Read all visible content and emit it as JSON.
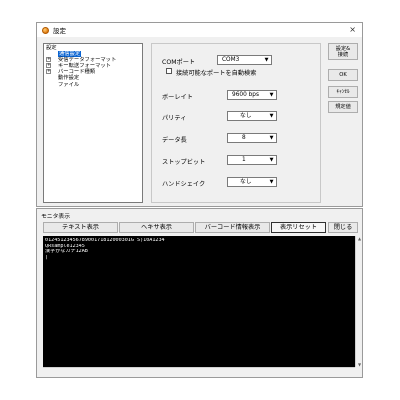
{
  "dialog": {
    "title": "設定",
    "close_icon": "×",
    "tree": [
      {
        "label": "設定",
        "indent": 0,
        "expander": "",
        "selected": false
      },
      {
        "label": "通信設定",
        "indent": 1,
        "expander": "",
        "selected": true
      },
      {
        "label": "受信データフォーマット",
        "indent": 1,
        "expander": "+",
        "selected": false
      },
      {
        "label": "キー転送フォーマット",
        "indent": 1,
        "expander": "+",
        "selected": false
      },
      {
        "label": "バーコード種類",
        "indent": 1,
        "expander": "+",
        "selected": false
      },
      {
        "label": "動作設定",
        "indent": 1,
        "expander": "",
        "selected": false
      },
      {
        "label": "ファイル",
        "indent": 1,
        "expander": "",
        "selected": false
      }
    ],
    "com_port": {
      "label": "COMポート",
      "value": "COM3"
    },
    "auto_search": {
      "label": "接続可能なポートを自動検索",
      "checked": false
    },
    "baud_rate": {
      "label": "ボーレイト",
      "value": "9600 bps"
    },
    "parity": {
      "label": "パリティ",
      "value": "なし"
    },
    "data_length": {
      "label": "データ長",
      "value": "8"
    },
    "stop_bit": {
      "label": "ストップビット",
      "value": "1"
    },
    "handshake": {
      "label": "ハンドシェイク",
      "value": "なし"
    },
    "buttons": {
      "apply": "設定&\n接続",
      "ok": "OK",
      "cancel": "ｷｬﾝｾﾙ",
      "defaults": "規定値"
    }
  },
  "monitor": {
    "title": "モニタ表示",
    "buttons": {
      "text_view": "テキスト表示",
      "hex_view": "ヘキサ表示",
      "barcode_info": "バーコード情報表示",
      "reset_view": "表示リセット",
      "close": "閉じる"
    },
    "console_lines": [
      "0124512345678900171812000301G S)10A1234",
      "QRsample12345",
      "漢字かなカナ12AB",
      "|"
    ]
  }
}
